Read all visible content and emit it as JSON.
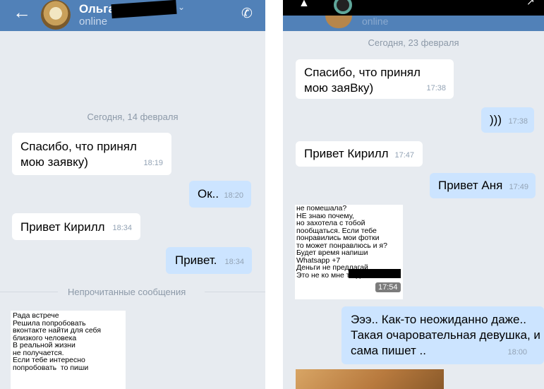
{
  "left": {
    "header": {
      "contact_name": "Ольга",
      "status": "online",
      "icons": {
        "back": "back-arrow-icon",
        "call": "phone-icon",
        "menu": "chevron-down-icon"
      },
      "colors": {
        "header": "#5181b8",
        "outgoing": "#cce4ff",
        "incoming": "#ffffff",
        "background": "#e7ebf0"
      }
    },
    "date": "Сегодня, 14 февраля",
    "messages": [
      {
        "text": "Спасибо, что принял мою заявку)",
        "time": "18:19"
      },
      {
        "text": "Ок..",
        "time": "18:20"
      },
      {
        "text": "Привет Кирилл",
        "time": "18:34"
      },
      {
        "text": "Привет.",
        "time": "18:34"
      }
    ],
    "unread_label": "Непрочитанные сообщения",
    "image_message": "Рада встрече\nРешила попробовать\nвконтакте найти для себя\nблизкого человека\nВ реальной жизни\nне получается.\nЕсли тебе интересно\nпопробовать  то пиши"
  },
  "right": {
    "header": {
      "status": "online"
    },
    "date": "Сегодня, 23 февраля",
    "messages": [
      {
        "text": "Спасибо, что принял мою заяВку)",
        "time": "17:38"
      },
      {
        "text": ")))",
        "time": "17:38"
      },
      {
        "text": "Привет Кирилл",
        "time": "17:47"
      },
      {
        "text": "Привет Аня",
        "time": "17:49"
      },
      {
        "text": "Эээ.. Как-то неожиданно даже.. Такая очаровательная девушка, и сама пишет ..",
        "time": "18:00"
      }
    ],
    "image_message": "не помешала?\nНЕ знаю почему,\nно захотела с тобой\nпообщаться. Если тебе\nпонравились мои фотки\nто может понравлюсь и я?\nБудет время напиши\nWhatsapp +7\nДеньги не предлагай\nЭто не ко мне тогда",
    "image_time": "17:54"
  }
}
